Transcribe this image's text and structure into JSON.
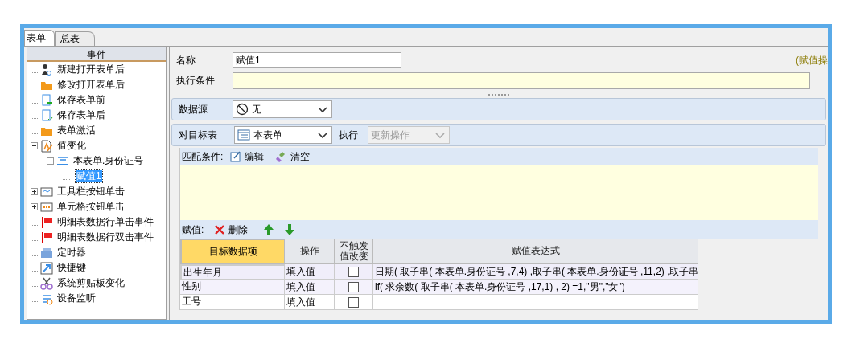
{
  "tabs": [
    {
      "label": "表单",
      "selected": true
    },
    {
      "label": "总表",
      "selected": false
    }
  ],
  "events_panel": {
    "header": "事件",
    "tree": [
      {
        "label": "新建打开表单后",
        "selected": false
      },
      {
        "label": "修改打开表单后",
        "selected": false
      },
      {
        "label": "保存表单前",
        "selected": false
      },
      {
        "label": "保存表单后",
        "selected": false
      },
      {
        "label": "表单激活",
        "selected": false
      },
      {
        "label": "值变化",
        "selected": false,
        "expanded": true,
        "children": [
          {
            "label": "本表单.身份证号",
            "selected": false,
            "expanded": true,
            "children": [
              {
                "label": "赋值1",
                "selected": true
              }
            ]
          }
        ]
      },
      {
        "label": "工具栏按钮单击",
        "selected": false,
        "expanded": false
      },
      {
        "label": "单元格按钮单击",
        "selected": false,
        "expanded": false
      },
      {
        "label": "明细表数据行单击事件",
        "selected": false
      },
      {
        "label": "明细表数据行双击事件",
        "selected": false
      },
      {
        "label": "定时器",
        "selected": false
      },
      {
        "label": "快捷键",
        "selected": false
      },
      {
        "label": "系统剪贴板变化",
        "selected": false
      },
      {
        "label": "设备监听",
        "selected": false
      }
    ]
  },
  "form": {
    "name_label": "名称",
    "name_value": "赋值1",
    "hint": "(赋值操",
    "condition_label": "执行条件",
    "datasource_label": "数据源",
    "datasource_value": "无",
    "target_label": "对目标表",
    "target_value": "本表单",
    "exec_label": "执行",
    "exec_value": "更新操作",
    "exec_disabled": true,
    "match_label": "匹配条件:",
    "edit_button": "编辑",
    "clear_button": "清空"
  },
  "assign": {
    "label": "赋值:",
    "delete_button": "删除",
    "columns": [
      "目标数据项",
      "操作",
      "不触发值改变",
      "赋值表达式"
    ],
    "rows": [
      {
        "target": "出生年月",
        "op": "填入值",
        "no_trigger": false,
        "expr": "日期( 取子串( 本表单.身份证号 ,7,4) ,取子串( 本表单.身份证号 ,11,2) ,取子串",
        "selected": true
      },
      {
        "target": "性别",
        "op": "填入值",
        "no_trigger": false,
        "expr": "if( 求余数( 取子串(  本表单.身份证号  ,17,1) , 2) =1,\"男\",\"女\")",
        "selected": false
      },
      {
        "target": "工号",
        "op": "填入值",
        "no_trigger": false,
        "selected": false
      }
    ]
  }
}
